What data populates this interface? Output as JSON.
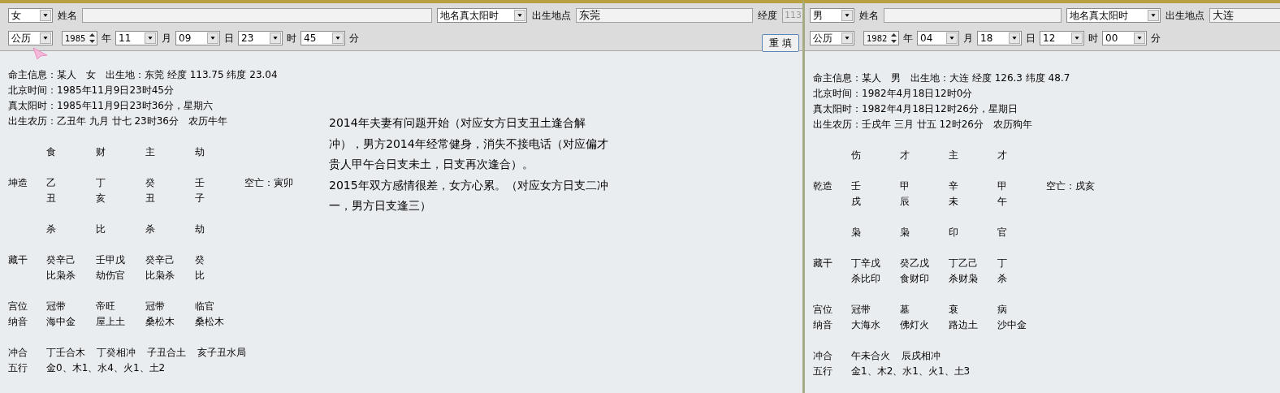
{
  "windows": [
    {
      "form": {
        "gender": "女",
        "name_label": "姓名",
        "timezone": "地名真太阳时",
        "place_label": "出生地点",
        "place": "东莞",
        "longitude_label": "经度",
        "longitude": {
          "value": "113",
          "disabled": true
        },
        "calendar": "公历",
        "year": "1985",
        "year_unit": "年",
        "month": "11",
        "month_unit": "月",
        "day": "09",
        "day_unit": "日",
        "hour": "23",
        "hour_unit": "时",
        "minute": "45",
        "minute_unit": "分",
        "reset_button": "重 填"
      },
      "info_lines": [
        "命主信息：某人　女　出生地：东莞 经度 113.75 纬度 23.04",
        "北京时间：1985年11月9日23时45分",
        "真太阳时：1985年11月9日23时36分，星期六",
        "出生农历：乙丑年 九月 廿七 23时36分　农历牛年"
      ],
      "chart_groups": [
        [
          {
            "cells": [
              "食",
              "财",
              "主",
              "劫"
            ]
          }
        ],
        [
          {
            "label": "坤造",
            "cells": [
              "乙",
              "丁",
              "癸",
              "壬"
            ],
            "extra": "空亡：寅卯"
          },
          {
            "cells": [
              "丑",
              "亥",
              "丑",
              "子"
            ]
          }
        ],
        [
          {
            "cells": [
              "杀",
              "比",
              "杀",
              "劫"
            ]
          }
        ],
        [
          {
            "label": "藏干",
            "cells": [
              "癸辛己",
              "壬甲戊",
              "癸辛己",
              "癸"
            ]
          },
          {
            "cells": [
              "比枭杀",
              "劫伤官",
              "比枭杀",
              "比"
            ]
          }
        ],
        [
          {
            "label": "宫位",
            "cells": [
              "冠带",
              "帝旺",
              "冠带",
              "临官"
            ]
          },
          {
            "label": "纳音",
            "cells": [
              "海中金",
              "屋上土",
              "桑松木",
              "桑松木"
            ]
          }
        ],
        [
          {
            "label": "冲合",
            "items": [
              "丁壬合木",
              "丁癸相冲",
              "子丑合土",
              "亥子丑水局"
            ]
          },
          {
            "label": "五行",
            "items": [
              "金0、木1、水4、火1、土2"
            ]
          }
        ]
      ],
      "notes": [
        "2014年夫妻有问题开始（对应女方日支丑土逢合解冲），男方2014年经常健身，消失不接电话（对应偏才贵人甲午合日支未土，日支再次逢合）。",
        "2015年双方感情很差，女方心累。（对应女方日支二冲一，男方日支逢三）"
      ]
    },
    {
      "form": {
        "gender": "男",
        "name_label": "姓名",
        "timezone": "地名真太阳时",
        "place_label": "出生地点",
        "place": "大连",
        "calendar": "公历",
        "year": "1982",
        "year_unit": "年",
        "month": "04",
        "month_unit": "月",
        "day": "18",
        "day_unit": "日",
        "hour": "12",
        "hour_unit": "时",
        "minute": "00",
        "minute_unit": "分"
      },
      "info_lines": [
        "命主信息：某人　男　出生地：大连 经度 126.3 纬度 48.7",
        "北京时间：1982年4月18日12时0分",
        "真太阳时：1982年4月18日12时26分，星期日",
        "出生农历：壬戌年 三月 廿五 12时26分　农历狗年"
      ],
      "chart_groups": [
        [
          {
            "cells": [
              "伤",
              "才",
              "主",
              "才"
            ]
          }
        ],
        [
          {
            "label": "乾造",
            "cells": [
              "壬",
              "甲",
              "辛",
              "甲"
            ],
            "extra": "空亡：戌亥"
          },
          {
            "cells": [
              "戌",
              "辰",
              "未",
              "午"
            ]
          }
        ],
        [
          {
            "cells": [
              "枭",
              "枭",
              "印",
              "官"
            ]
          }
        ],
        [
          {
            "label": "藏干",
            "cells": [
              "丁辛戊",
              "癸乙戊",
              "丁乙己",
              "丁"
            ]
          },
          {
            "cells": [
              "杀比印",
              "食财印",
              "杀财枭",
              "杀"
            ]
          }
        ],
        [
          {
            "label": "宫位",
            "cells": [
              "冠带",
              "墓",
              "衰",
              "病"
            ]
          },
          {
            "label": "纳音",
            "cells": [
              "大海水",
              "佛灯火",
              "路边土",
              "沙中金"
            ]
          }
        ],
        [
          {
            "label": "冲合",
            "items": [
              "午未合火",
              "辰戌相冲"
            ]
          },
          {
            "label": "五行",
            "items": [
              "金1、木2、水1、火1、土3"
            ]
          }
        ]
      ]
    }
  ]
}
